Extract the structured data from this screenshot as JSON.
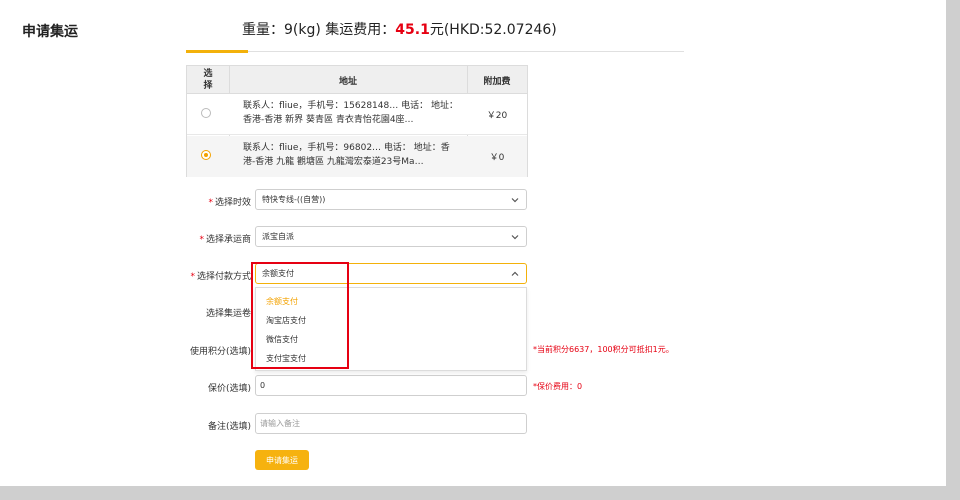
{
  "page": {
    "title": "申请集运",
    "weight_label": "重量：",
    "weight_value": "9(kg)",
    "fee_label": " 集运费用：",
    "fee_value": "45.1",
    "fee_suffix": "元(HKD:52.07246)"
  },
  "address_table": {
    "headers": {
      "select": "选择",
      "address": "地址",
      "surcharge": "附加费"
    },
    "rows": [
      {
        "address": "联系人：fliue，手机号：15628148… 电话： 地址：香港-香港 新界 葵青區 青衣青怡花園4座…",
        "surcharge": "￥20",
        "selected": false
      },
      {
        "address": "联系人：fliue，手机号：96802… 电话： 地址：香港-香港 九龍 觀塘區 九龍灣宏泰道23号Ma…",
        "surcharge": "￥0",
        "selected": true
      }
    ]
  },
  "form": {
    "timeliness": {
      "label": "选择时效",
      "value": "特快专线-((自营))"
    },
    "carrier": {
      "label": "选择承运商",
      "value": "派宝自派"
    },
    "payment": {
      "label": "选择付款方式",
      "value": "余额支付",
      "options": [
        "余额支付",
        "淘宝店支付",
        "微信支付",
        "支付宝支付"
      ]
    },
    "coupon": {
      "label": "选择集运卷"
    },
    "points": {
      "label": "使用积分(选填)",
      "note": "*当前积分6637，100积分可抵扣1元。"
    },
    "insurance": {
      "label": "保价(选填)",
      "value": "0",
      "note": "*保价费用：0"
    },
    "remark": {
      "label": "备注(选填)",
      "placeholder": "请输入备注"
    },
    "submit_label": "申请集运"
  },
  "colors": {
    "accent": "#f3b10a",
    "red": "#e60012"
  }
}
